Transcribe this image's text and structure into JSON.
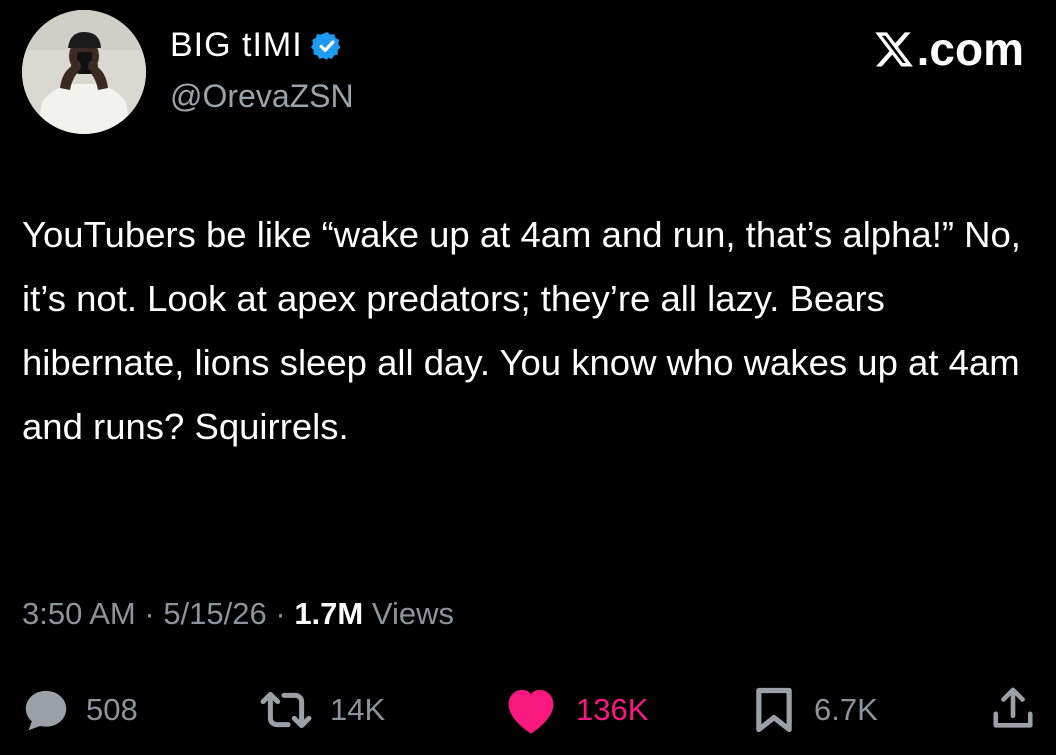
{
  "author": {
    "display_name": "BIG tIMI",
    "handle": "@OrevaZSN",
    "verified": true,
    "avatar_icon": "profile-photo"
  },
  "brand": {
    "label": ".com",
    "icon": "x-logo-icon"
  },
  "tweet": {
    "text": "YouTubers be like “wake up at 4am and run, that’s alpha!” No, it’s not. Look at apex predators; they’re all lazy. Bears hibernate, lions sleep all day. You know who wakes up at 4am and runs? Squirrels."
  },
  "meta": {
    "time": "3:50 AM",
    "sep1": " · ",
    "date": "5/15/26",
    "sep2": " · ",
    "views_count": "1.7M",
    "views_label": " Views"
  },
  "actions": {
    "replies": "508",
    "reposts": "14K",
    "likes": "136K",
    "bookmarks": "6.7K"
  },
  "colors": {
    "background": "#000000",
    "text": "#ffffff",
    "secondary": "#8b949c",
    "verified_blue": "#1d9bf0",
    "like_pink": "#f91880"
  }
}
